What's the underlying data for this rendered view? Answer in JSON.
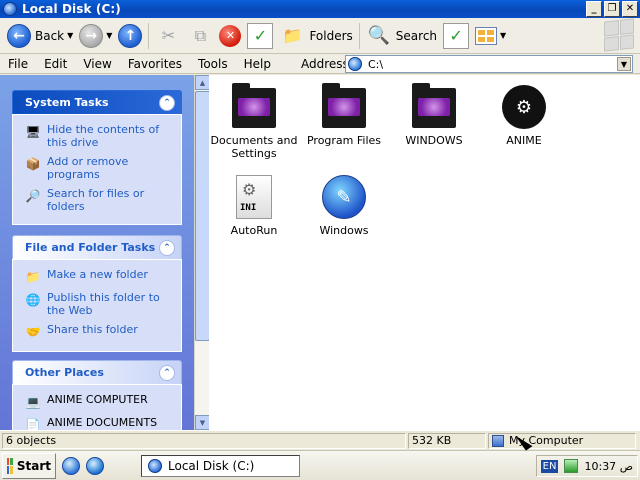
{
  "window": {
    "title": "Local Disk (C:)"
  },
  "toolbar": {
    "back_label": "Back",
    "folders_label": "Folders",
    "search_label": "Search"
  },
  "menu": [
    "File",
    "Edit",
    "View",
    "Favorites",
    "Tools",
    "Help"
  ],
  "address": {
    "label": "Address",
    "value": "C:\\"
  },
  "left_panels": {
    "system_tasks": {
      "title": "System Tasks",
      "items": [
        {
          "label": "Hide the contents of this drive",
          "icon": "hide-contents-icon"
        },
        {
          "label": "Add or remove programs",
          "icon": "add-remove-programs-icon"
        },
        {
          "label": "Search for files or folders",
          "icon": "search-icon"
        }
      ]
    },
    "file_folder_tasks": {
      "title": "File and Folder Tasks",
      "items": [
        {
          "label": "Make a new folder",
          "icon": "new-folder-icon"
        },
        {
          "label": "Publish this folder to the Web",
          "icon": "publish-web-icon"
        },
        {
          "label": "Share this folder",
          "icon": "share-folder-icon"
        }
      ]
    },
    "other_places": {
      "title": "Other Places",
      "items": [
        {
          "label": "ANIME COMPUTER",
          "icon": "computer-icon"
        },
        {
          "label": "ANIME DOCUMENTS",
          "icon": "documents-icon"
        }
      ]
    }
  },
  "files": [
    {
      "name": "Documents and Settings",
      "type": "folder"
    },
    {
      "name": "Program Files",
      "type": "folder"
    },
    {
      "name": "WINDOWS",
      "type": "folder"
    },
    {
      "name": "ANIME",
      "type": "steam"
    },
    {
      "name": "AutoRun",
      "type": "ini"
    },
    {
      "name": "Windows",
      "type": "app"
    }
  ],
  "status": {
    "objects": "6 objects",
    "size": "532 KB",
    "location": "My Computer"
  },
  "taskbar": {
    "start_label": "Start",
    "task_label": "Local Disk (C:)",
    "lang": "EN",
    "clock": "10:37 ص"
  }
}
